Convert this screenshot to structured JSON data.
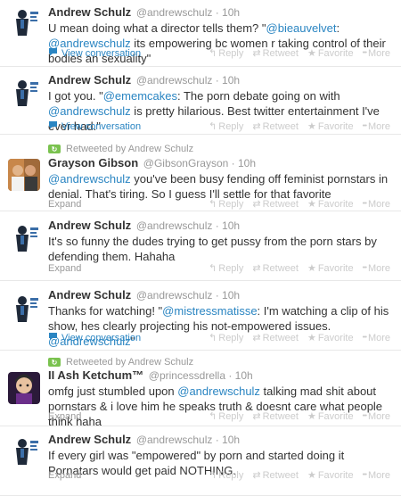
{
  "tweets": [
    {
      "name": "Andrew Schulz",
      "handle": "@andrewschulz",
      "time": "10h",
      "text_parts": [
        {
          "t": "U mean doing what a director tells them? \"",
          "m": false
        },
        {
          "t": "@bieauvelvet",
          "m": true
        },
        {
          "t": ": ",
          "m": false
        },
        {
          "t": "@andrewschulz",
          "m": true
        },
        {
          "t": " its empowering bc women r taking control of their bodies an sexuality\"",
          "m": false
        }
      ],
      "footer_label": "View conversation"
    },
    {
      "name": "Andrew Schulz",
      "handle": "@andrewschulz",
      "time": "10h",
      "text_parts": [
        {
          "t": "I got you. \"",
          "m": false
        },
        {
          "t": "@ememcakes",
          "m": true
        },
        {
          "t": ": The porn debate going on with ",
          "m": false
        },
        {
          "t": "@andrewschulz",
          "m": true
        },
        {
          "t": " is pretty hilarious. Best twitter entertainment I've ever had.\"",
          "m": false
        }
      ],
      "footer_label": "View conversation"
    },
    {
      "retweeted_by": "Retweeted by Andrew Schulz",
      "name": "Grayson Gibson",
      "handle": "@GibsonGrayson",
      "time": "10h",
      "text_parts": [
        {
          "t": "@andrewschulz",
          "m": true
        },
        {
          "t": " you've been busy fending off feminist pornstars in denial. That's tiring. So I guess I'll settle for that favorite",
          "m": false
        }
      ],
      "footer_label": "Expand"
    },
    {
      "name": "Andrew Schulz",
      "handle": "@andrewschulz",
      "time": "10h",
      "text_parts": [
        {
          "t": "It's so funny the dudes trying to get pussy from the porn stars by defending them. Hahaha",
          "m": false
        }
      ],
      "footer_label": "Expand"
    },
    {
      "name": "Andrew Schulz",
      "handle": "@andrewschulz",
      "time": "10h",
      "text_parts": [
        {
          "t": "Thanks for watching! \"",
          "m": false
        },
        {
          "t": "@mistressmatisse",
          "m": true
        },
        {
          "t": ": I'm watching a clip of his show, hes clearly projecting his not-empowered issues. ",
          "m": false
        },
        {
          "t": "@andrewschulz",
          "m": true
        },
        {
          "t": "\"",
          "m": false
        }
      ],
      "footer_label": "View conversation"
    },
    {
      "retweeted_by": "Retweeted by Andrew Schulz",
      "name": "II Ash Ketchum™",
      "handle": "@princessdrella",
      "time": "10h",
      "text_parts": [
        {
          "t": "omfg just stumbled upon ",
          "m": false
        },
        {
          "t": "@andrewschulz",
          "m": true
        },
        {
          "t": " talking mad shit about pornstars & i love him he speaks truth & doesnt care what people think haha",
          "m": false
        }
      ],
      "footer_label": "Expand"
    },
    {
      "name": "Andrew Schulz",
      "handle": "@andrewschulz",
      "time": "10h",
      "text_parts": [
        {
          "t": "If every girl was \"empowered\" by porn and started doing it Pornatars would get paid NOTHING.",
          "m": false
        }
      ],
      "footer_label": "Expand"
    }
  ],
  "actions": {
    "reply": "Reply",
    "retweet": "Retweet",
    "favorite": "Favorite",
    "more": "More"
  },
  "icons": {
    "reply": "reply-arrow-icon",
    "retweet": "retweet-icon",
    "favorite": "star-icon",
    "more": "more-dots-icon",
    "conversation": "speech-bubble-icon"
  },
  "colors": {
    "link": "#2a85c2",
    "retweet_badge": "#7ac24f",
    "muted": "#999999"
  }
}
